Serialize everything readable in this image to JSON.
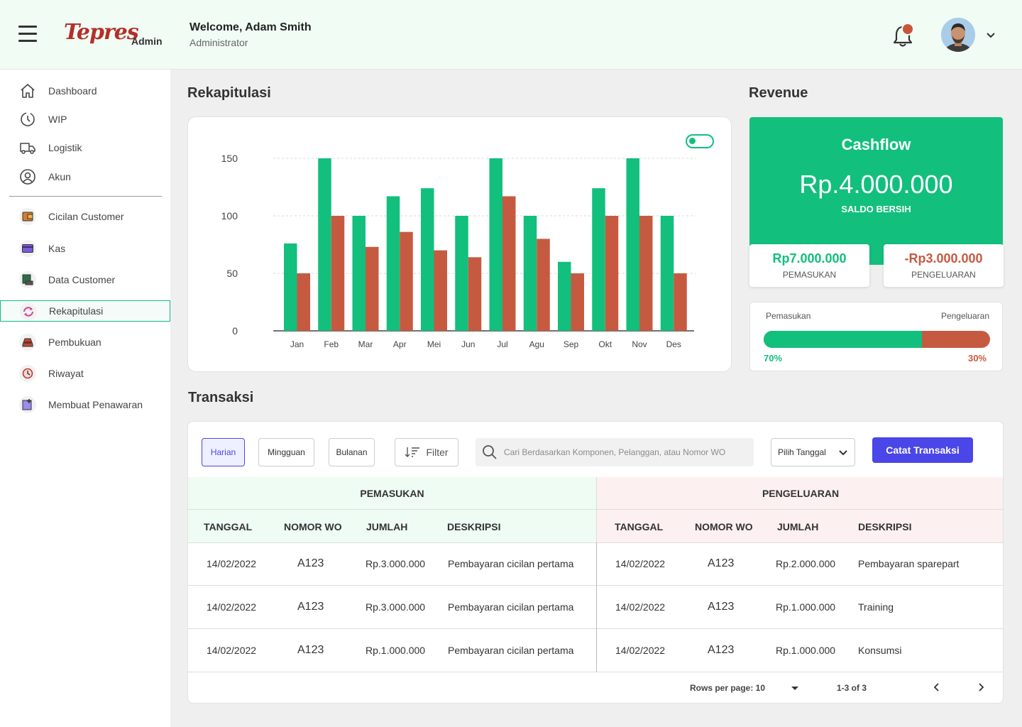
{
  "header": {
    "logo_text": "Tepres",
    "logo_sub": "Admin",
    "welcome": "Welcome, Adam Smith",
    "role": "Administrator"
  },
  "sidebar": {
    "items": [
      {
        "label": "Dashboard",
        "icon": "home-icon"
      },
      {
        "label": "WIP",
        "icon": "wip-icon"
      },
      {
        "label": "Logistik",
        "icon": "truck-icon"
      },
      {
        "label": "Akun",
        "icon": "user-icon"
      },
      {
        "label": "Cicilan Customer",
        "icon": "wallet-icon"
      },
      {
        "label": "Kas",
        "icon": "card-icon"
      },
      {
        "label": "Data Customer",
        "icon": "register-icon"
      },
      {
        "label": "Rekapitulasi",
        "icon": "recap-icon",
        "active": true
      },
      {
        "label": "Pembukuan",
        "icon": "ledger-icon"
      },
      {
        "label": "Riwayat",
        "icon": "history-icon"
      },
      {
        "label": "Membuat Penawaran",
        "icon": "add-offer-icon"
      }
    ]
  },
  "rekap": {
    "title": "Rekapitulasi"
  },
  "chart_data": {
    "type": "bar",
    "categories": [
      "Jan",
      "Feb",
      "Mar",
      "Apr",
      "Mei",
      "Jun",
      "Jul",
      "Agu",
      "Sep",
      "Okt",
      "Nov",
      "Des"
    ],
    "series": [
      {
        "values": [
          76,
          150,
          100,
          117,
          124,
          100,
          150,
          100,
          60,
          124,
          150,
          100
        ],
        "color": "#12bf7d"
      },
      {
        "values": [
          50,
          100,
          73,
          86,
          70,
          64,
          117,
          80,
          50,
          100,
          100,
          50
        ],
        "color": "#c65a41"
      }
    ],
    "yticks": [
      0,
      50,
      100,
      150
    ],
    "ylim": [
      0,
      150
    ],
    "grid": true,
    "title": "",
    "xlabel": "",
    "ylabel": ""
  },
  "revenue": {
    "title": "Revenue",
    "cashflow_title": "Cashflow",
    "cashflow_amount": "Rp.4.000.000",
    "cashflow_sub": "SALDO BERSIH",
    "income_amount": "Rp7.000.000",
    "income_label": "PEMASUKAN",
    "expense_amount": "-Rp3.000.000",
    "expense_label": "PENGELUARAN",
    "ratio_left_label": "Pemasukan",
    "ratio_right_label": "Pengeluaran",
    "ratio_left_pct": "70%",
    "ratio_right_pct": "30%",
    "ratio_fraction": 0.7,
    "colors": {
      "income": "#12bf7d",
      "expense": "#c65a41"
    }
  },
  "transaksi": {
    "title": "Transaksi",
    "filters": [
      "Harian",
      "Mingguan",
      "Bulanan"
    ],
    "filter_button": "Filter",
    "search_placeholder": "Cari Berdasarkan Komponen, Pelanggan, atau Nomor WO",
    "date_select": "Pilih Tanggal",
    "primary_button": "Catat Transaksi",
    "income_group": "PEMASUKAN",
    "expense_group": "PENGELUARAN",
    "columns": [
      "TANGGAL",
      "NOMOR WO",
      "JUMLAH",
      "DESKRIPSI"
    ],
    "income_rows": [
      [
        "14/02/2022",
        "A123",
        "Rp.3.000.000",
        "Pembayaran cicilan pertama"
      ],
      [
        "14/02/2022",
        "A123",
        "Rp.3.000.000",
        "Pembayaran cicilan pertama"
      ],
      [
        "14/02/2022",
        "A123",
        "Rp.1.000.000",
        "Pembayaran cicilan pertama"
      ]
    ],
    "expense_rows": [
      [
        "14/02/2022",
        "A123",
        "Rp.2.000.000",
        "Pembayaran sparepart"
      ],
      [
        "14/02/2022",
        "A123",
        "Rp.1.000.000",
        "Training"
      ],
      [
        "14/02/2022",
        "A123",
        "Rp.1.000.000",
        "Konsumsi"
      ]
    ],
    "rows_per_page": "Rows per page: 10",
    "range": "1-3 of 3"
  }
}
